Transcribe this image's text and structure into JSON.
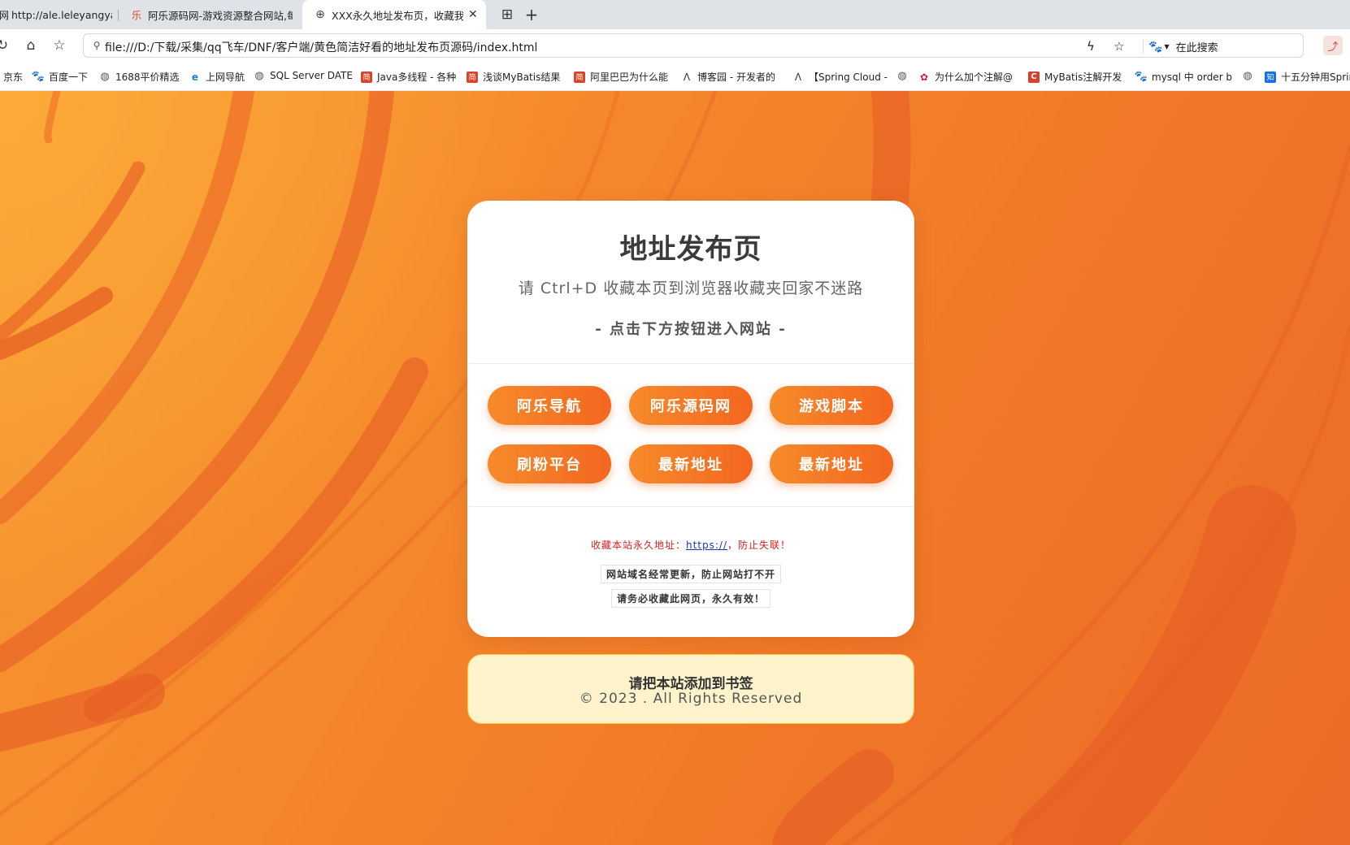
{
  "browser": {
    "tabs": [
      {
        "label": "http://ale.leleyangyan",
        "icon_text": "网",
        "active": false
      },
      {
        "label": "阿乐源码网-游戏资源整合网站,每",
        "icon_text": "乐",
        "active": false
      },
      {
        "label": "XXX永久地址发布页，收藏我",
        "icon_text": "⊕",
        "active": true
      }
    ],
    "tab_grid_icon": "⊞",
    "new_tab_icon": "+",
    "url": "file:///D:/下载/采集/qq飞车/DNF/客户端/黄色简洁好看的地址发布页源码/index.html",
    "search_engine_label": "在此搜索",
    "bookmarks": [
      {
        "label": "京东",
        "icon": "none",
        "icon_text": ""
      },
      {
        "label": "百度一下",
        "icon": "baidu",
        "icon_text": "🐾"
      },
      {
        "label": "1688平价精选",
        "icon": "globe",
        "icon_text": "◍"
      },
      {
        "label": "上网导航",
        "icon": "edge",
        "icon_text": "e"
      },
      {
        "label": "SQL Server DATE",
        "icon": "globe",
        "icon_text": "◍"
      },
      {
        "label": "Java多线程 - 各种",
        "icon": "jian",
        "icon_text": "简"
      },
      {
        "label": "浅谈MyBatis结果",
        "icon": "jian",
        "icon_text": "简"
      },
      {
        "label": "阿里巴巴为什么能",
        "icon": "jian",
        "icon_text": "简"
      },
      {
        "label": "博客园 - 开发者的",
        "icon": "cnb",
        "icon_text": "ⴷ"
      },
      {
        "label": "【Spring Cloud -",
        "icon": "cnb",
        "icon_text": "ⴷ"
      },
      {
        "label": "",
        "icon": "globe",
        "icon_text": "◍"
      },
      {
        "label": "为什么加个注解@",
        "icon": "hw",
        "icon_text": "✿"
      },
      {
        "label": "MyBatis注解开发",
        "icon": "csdn",
        "icon_text": "C"
      },
      {
        "label": "mysql 中 order b",
        "icon": "baidu",
        "icon_text": "🐾"
      },
      {
        "label": "",
        "icon": "globe",
        "icon_text": "◍"
      },
      {
        "label": "十五分钟用Sprin",
        "icon": "zhi",
        "icon_text": "知"
      }
    ]
  },
  "card": {
    "title": "地址发布页",
    "subtitle": "请 Ctrl+D 收藏本页到浏览器收藏夹回家不迷路",
    "hint": "- 点击下方按钮进入网站 -",
    "buttons": [
      "阿乐导航",
      "阿乐源码网",
      "游戏脚本",
      "刷粉平台",
      "最新地址",
      "最新地址"
    ],
    "permanent_prefix": "收藏本站永久地址：",
    "permanent_link": "https://",
    "permanent_suffix": "，防止失联！",
    "notice_1": "网站域名经常更新，防止网站打不开",
    "notice_2": "请务必收藏此网页，永久有效！"
  },
  "footer": {
    "line1": "请把本站添加到书签",
    "line2": "© 2023 . All Rights Reserved"
  },
  "colors": {
    "background": "#f07a2a",
    "button_start": "#f68b2a",
    "button_end": "#f4661f",
    "footer_bg": "#fff3cc",
    "footer_border": "#f3c64a",
    "warning_text": "#d32020",
    "link": "#1a35c9"
  }
}
